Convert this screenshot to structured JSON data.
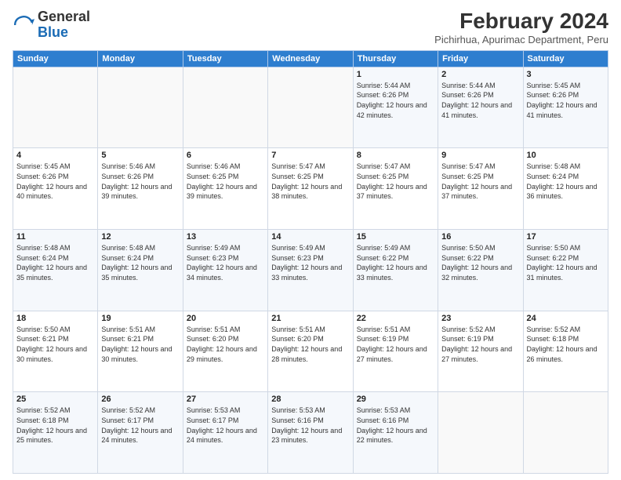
{
  "header": {
    "logo_general": "General",
    "logo_blue": "Blue",
    "month_year": "February 2024",
    "location": "Pichirhua, Apurimac Department, Peru"
  },
  "days_of_week": [
    "Sunday",
    "Monday",
    "Tuesday",
    "Wednesday",
    "Thursday",
    "Friday",
    "Saturday"
  ],
  "weeks": [
    [
      {
        "day": "",
        "info": ""
      },
      {
        "day": "",
        "info": ""
      },
      {
        "day": "",
        "info": ""
      },
      {
        "day": "",
        "info": ""
      },
      {
        "day": "1",
        "info": "Sunrise: 5:44 AM\nSunset: 6:26 PM\nDaylight: 12 hours\nand 42 minutes."
      },
      {
        "day": "2",
        "info": "Sunrise: 5:44 AM\nSunset: 6:26 PM\nDaylight: 12 hours\nand 41 minutes."
      },
      {
        "day": "3",
        "info": "Sunrise: 5:45 AM\nSunset: 6:26 PM\nDaylight: 12 hours\nand 41 minutes."
      }
    ],
    [
      {
        "day": "4",
        "info": "Sunrise: 5:45 AM\nSunset: 6:26 PM\nDaylight: 12 hours\nand 40 minutes."
      },
      {
        "day": "5",
        "info": "Sunrise: 5:46 AM\nSunset: 6:26 PM\nDaylight: 12 hours\nand 39 minutes."
      },
      {
        "day": "6",
        "info": "Sunrise: 5:46 AM\nSunset: 6:25 PM\nDaylight: 12 hours\nand 39 minutes."
      },
      {
        "day": "7",
        "info": "Sunrise: 5:47 AM\nSunset: 6:25 PM\nDaylight: 12 hours\nand 38 minutes."
      },
      {
        "day": "8",
        "info": "Sunrise: 5:47 AM\nSunset: 6:25 PM\nDaylight: 12 hours\nand 37 minutes."
      },
      {
        "day": "9",
        "info": "Sunrise: 5:47 AM\nSunset: 6:25 PM\nDaylight: 12 hours\nand 37 minutes."
      },
      {
        "day": "10",
        "info": "Sunrise: 5:48 AM\nSunset: 6:24 PM\nDaylight: 12 hours\nand 36 minutes."
      }
    ],
    [
      {
        "day": "11",
        "info": "Sunrise: 5:48 AM\nSunset: 6:24 PM\nDaylight: 12 hours\nand 35 minutes."
      },
      {
        "day": "12",
        "info": "Sunrise: 5:48 AM\nSunset: 6:24 PM\nDaylight: 12 hours\nand 35 minutes."
      },
      {
        "day": "13",
        "info": "Sunrise: 5:49 AM\nSunset: 6:23 PM\nDaylight: 12 hours\nand 34 minutes."
      },
      {
        "day": "14",
        "info": "Sunrise: 5:49 AM\nSunset: 6:23 PM\nDaylight: 12 hours\nand 33 minutes."
      },
      {
        "day": "15",
        "info": "Sunrise: 5:49 AM\nSunset: 6:22 PM\nDaylight: 12 hours\nand 33 minutes."
      },
      {
        "day": "16",
        "info": "Sunrise: 5:50 AM\nSunset: 6:22 PM\nDaylight: 12 hours\nand 32 minutes."
      },
      {
        "day": "17",
        "info": "Sunrise: 5:50 AM\nSunset: 6:22 PM\nDaylight: 12 hours\nand 31 minutes."
      }
    ],
    [
      {
        "day": "18",
        "info": "Sunrise: 5:50 AM\nSunset: 6:21 PM\nDaylight: 12 hours\nand 30 minutes."
      },
      {
        "day": "19",
        "info": "Sunrise: 5:51 AM\nSunset: 6:21 PM\nDaylight: 12 hours\nand 30 minutes."
      },
      {
        "day": "20",
        "info": "Sunrise: 5:51 AM\nSunset: 6:20 PM\nDaylight: 12 hours\nand 29 minutes."
      },
      {
        "day": "21",
        "info": "Sunrise: 5:51 AM\nSunset: 6:20 PM\nDaylight: 12 hours\nand 28 minutes."
      },
      {
        "day": "22",
        "info": "Sunrise: 5:51 AM\nSunset: 6:19 PM\nDaylight: 12 hours\nand 27 minutes."
      },
      {
        "day": "23",
        "info": "Sunrise: 5:52 AM\nSunset: 6:19 PM\nDaylight: 12 hours\nand 27 minutes."
      },
      {
        "day": "24",
        "info": "Sunrise: 5:52 AM\nSunset: 6:18 PM\nDaylight: 12 hours\nand 26 minutes."
      }
    ],
    [
      {
        "day": "25",
        "info": "Sunrise: 5:52 AM\nSunset: 6:18 PM\nDaylight: 12 hours\nand 25 minutes."
      },
      {
        "day": "26",
        "info": "Sunrise: 5:52 AM\nSunset: 6:17 PM\nDaylight: 12 hours\nand 24 minutes."
      },
      {
        "day": "27",
        "info": "Sunrise: 5:53 AM\nSunset: 6:17 PM\nDaylight: 12 hours\nand 24 minutes."
      },
      {
        "day": "28",
        "info": "Sunrise: 5:53 AM\nSunset: 6:16 PM\nDaylight: 12 hours\nand 23 minutes."
      },
      {
        "day": "29",
        "info": "Sunrise: 5:53 AM\nSunset: 6:16 PM\nDaylight: 12 hours\nand 22 minutes."
      },
      {
        "day": "",
        "info": ""
      },
      {
        "day": "",
        "info": ""
      }
    ]
  ]
}
